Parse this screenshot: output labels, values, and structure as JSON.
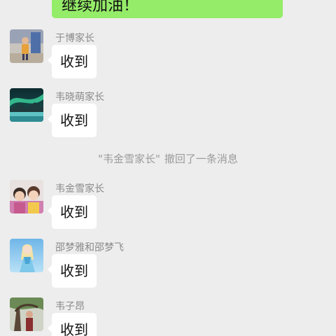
{
  "self_message": {
    "text": "继续加油！",
    "bubble_color": "#95ec69"
  },
  "messages": [
    {
      "sender": "于博家长",
      "text": "收到",
      "avatar": "child-standing-photo-avatar"
    },
    {
      "sender": "韦晓萌家长",
      "text": "收到",
      "avatar": "aurora-landscape-avatar"
    },
    {
      "sender": "韦金雪家长",
      "text": "收到",
      "avatar": "two-children-photo-avatar"
    },
    {
      "sender": "邵梦雅和邵梦飞",
      "text": "收到",
      "avatar": "ice-princess-avatar"
    },
    {
      "sender": "韦子昂",
      "text": "收到",
      "avatar": "person-under-tree-avatar"
    }
  ],
  "system_notice": {
    "name": "\"韦金雪家长\"",
    "text": "撤回了一条消息"
  },
  "colors": {
    "background": "#ededed",
    "incoming_bubble": "#ffffff",
    "sender_text": "#8a8a8a",
    "system_text": "#9b9b9b"
  }
}
